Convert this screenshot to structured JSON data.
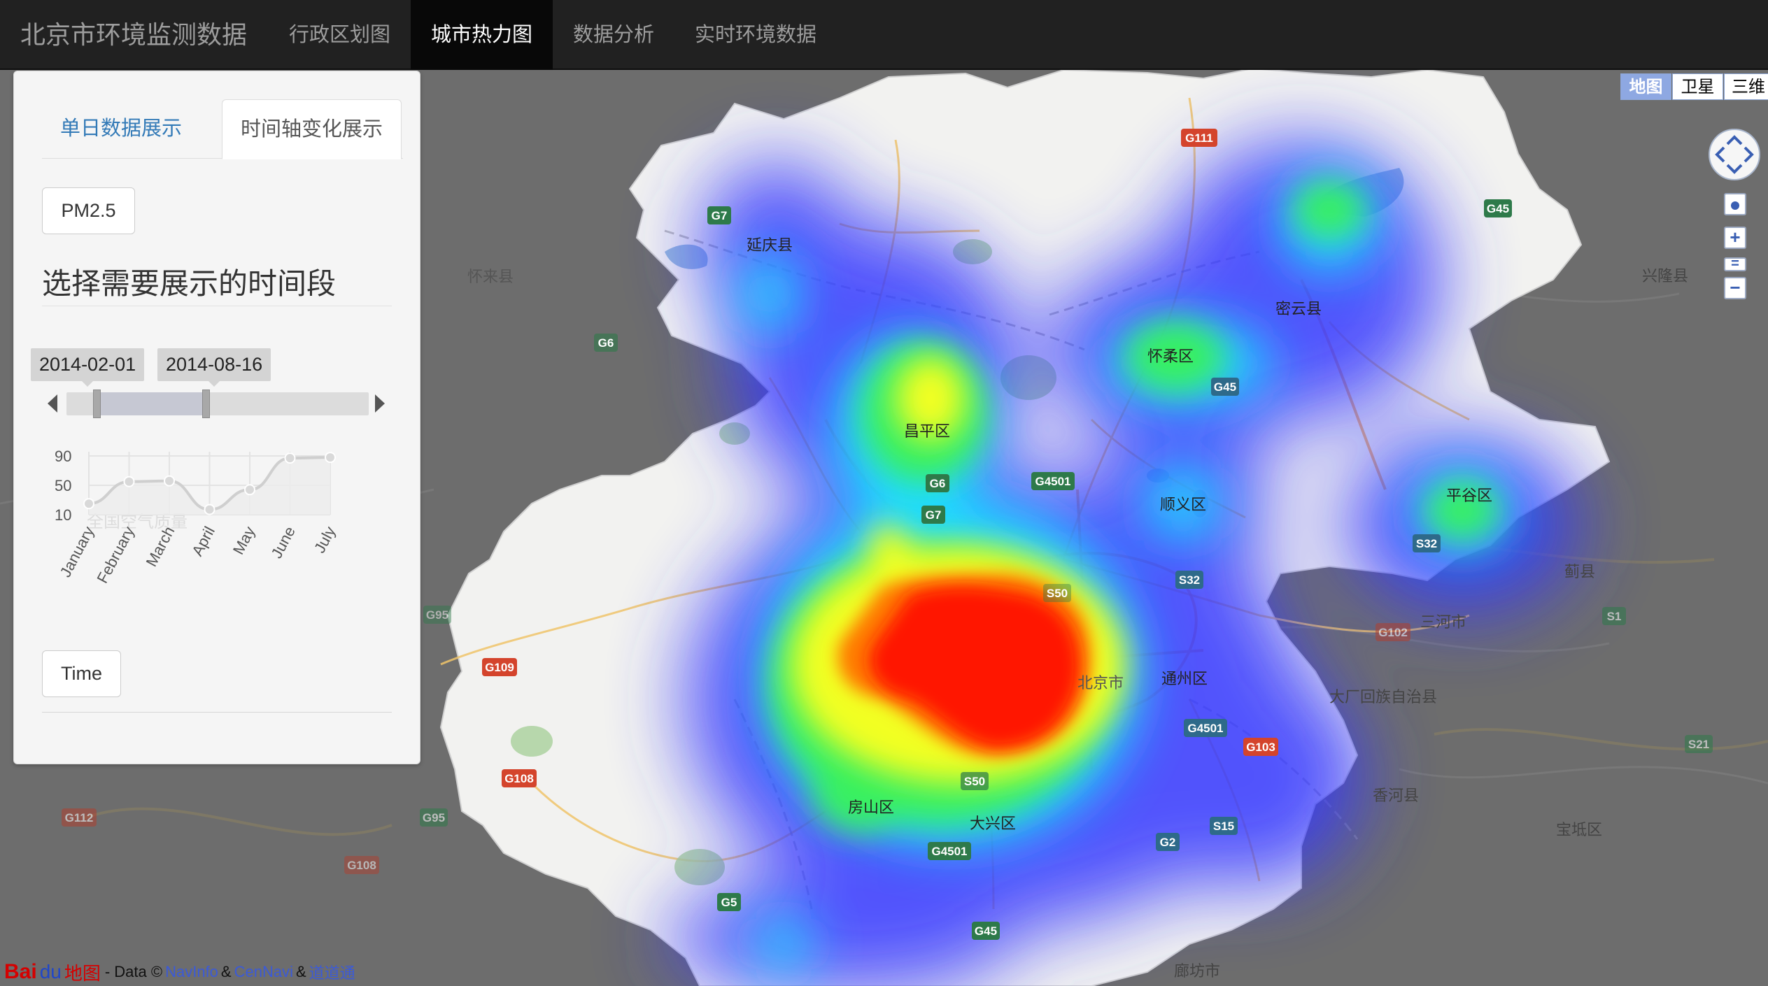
{
  "nav": {
    "brand": "北京市环境监测数据",
    "items": [
      {
        "label": "行政区划图"
      },
      {
        "label": "城市热力图"
      },
      {
        "label": "数据分析"
      },
      {
        "label": "实时环境数据"
      }
    ]
  },
  "panel": {
    "tabs": [
      "单日数据展示",
      "时间轴变化展示"
    ],
    "active_tab": "时间轴变化展示",
    "pm_button": "PM2.5",
    "heading": "选择需要展示的时间段",
    "range_start": "2014-02-01",
    "range_end": "2014-08-16",
    "time_button": "Time"
  },
  "mini_chart": {
    "watermark": "全国空气质量",
    "y_ticks": [
      "90",
      "50",
      "10"
    ],
    "months": [
      "January",
      "February",
      "March",
      "April",
      "May",
      "June",
      "July"
    ],
    "values": [
      25,
      55,
      56,
      17,
      44,
      87,
      88
    ],
    "ylim": [
      10,
      90
    ]
  },
  "map": {
    "type_buttons": [
      "地图",
      "卫星",
      "三维"
    ],
    "active_type": "地图",
    "zoom_in": "+",
    "zoom_out": "−",
    "labels": {
      "yanqing": "延庆县",
      "huailai": "怀来县",
      "miyun": "密云县",
      "huairou": "怀柔区",
      "changping": "昌平区",
      "shunyi": "顺义区",
      "pinggu": "平谷区",
      "xinglong": "兴隆县",
      "jixian": "蓟县",
      "sanhe": "三河市",
      "tongzhou": "通州区",
      "dachang": "大厂回族自治县",
      "xianghe": "香河县",
      "baodi": "宝坻区",
      "fangshan": "房山区",
      "daxing": "大兴区",
      "langfang": "廊坊市",
      "city": "北京市"
    },
    "shields": {
      "g111": "G111",
      "g7": "G7",
      "g45a": "G45",
      "g6a": "G6",
      "g45b": "G45",
      "g4501a": "G4501",
      "g6b": "G6",
      "g7b": "G7",
      "s32a": "S32",
      "s32b": "S32",
      "g109": "G109",
      "g4501b": "G4501",
      "g103": "G103",
      "g108a": "G108",
      "s50a": "S50",
      "s50b": "S50",
      "g4501c": "G4501",
      "s15": "S15",
      "g2": "G2",
      "g5": "G5",
      "g45c": "G45",
      "g112": "G112",
      "g95a": "G95",
      "g95b": "G95",
      "g108b": "G108",
      "g102": "G102",
      "s1": "S1",
      "s21": "S21"
    }
  },
  "footer": {
    "logo": "Bai",
    "logo_paw": "du",
    "logo_map": "地图",
    "prefix": "- Data ©",
    "src1": "NavInfo",
    "amp": "&",
    "src2": "CenNavi",
    "src3": "道道通"
  }
}
